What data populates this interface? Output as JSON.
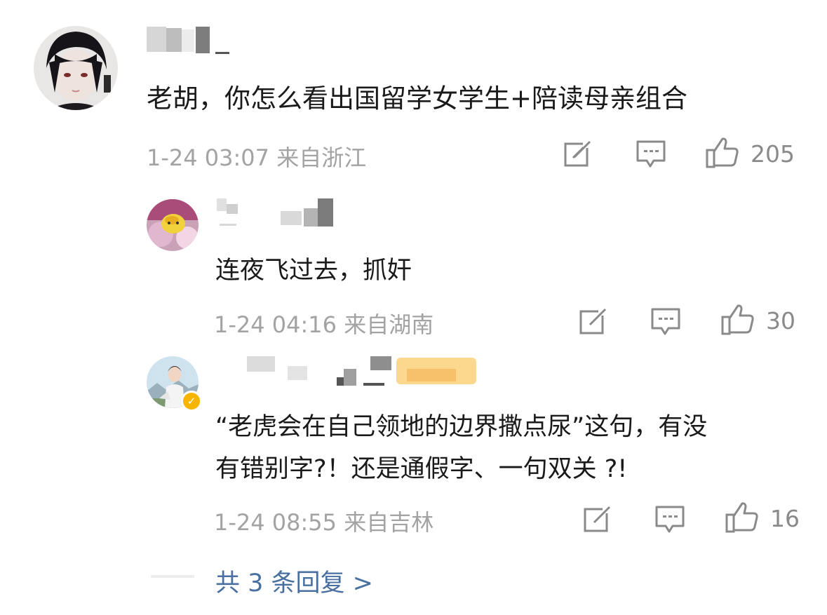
{
  "comment": {
    "text": "老胡，你怎么看出国留学女学生+陪读母亲组合",
    "time": "1-24 03:07 来自浙江",
    "likes": "205",
    "icons": {
      "share": "share-icon",
      "reply": "comment-icon",
      "like": "thumbs-up-icon"
    }
  },
  "replies": [
    {
      "text": "连夜飞过去，抓奸",
      "time": "1-24 04:16 来自湖南",
      "likes": "30"
    },
    {
      "text_line1": "“老虎会在自己领地的边界撒点尿”这句，有没",
      "text_line2": "有错别字?！还是通假字、一句双关 ?!",
      "time": "1-24 08:55 来自吉林",
      "likes": "16",
      "verified_badge": "v-badge-icon"
    }
  ],
  "more_replies": "共 3 条回复 >",
  "colors": {
    "meta": "#a3a3a3",
    "link": "#4a6fa1",
    "text": "#1a1a1a",
    "icon": "#8a8a8a"
  }
}
